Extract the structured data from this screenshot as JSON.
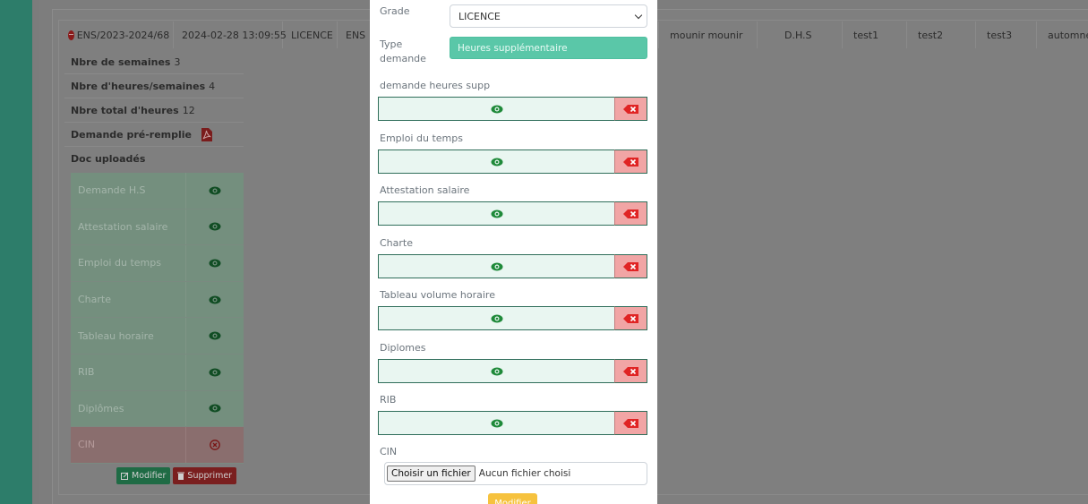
{
  "background_table": {
    "first_row": {
      "reference": "ENS/2023-2024/68",
      "date": "2024-02-28 13:09:55",
      "grade": "LICENCE",
      "type_short": "ENS",
      "name": "mounir mounir",
      "category": "D.H.S",
      "col_test1": "test1",
      "col_test2": "test2",
      "col_test3": "test3",
      "col_season": "automne"
    },
    "details": {
      "weeks_label": "Nbre de semaines",
      "weeks_value": "3",
      "hours_per_week_label": "Nbre d'heures/semaines",
      "hours_per_week_value": "4",
      "total_hours_label": "Nbre total d'heures",
      "total_hours_value": "12",
      "prefilled_label": "Demande pré-remplie",
      "uploaded_label": "Doc uploadés"
    },
    "docs": [
      {
        "name": "Demande H.S",
        "status": "ok"
      },
      {
        "name": "Attestation salaire",
        "status": "ok"
      },
      {
        "name": "Emploi du temps",
        "status": "ok"
      },
      {
        "name": "Charte",
        "status": "ok"
      },
      {
        "name": "Tableau horaire",
        "status": "ok"
      },
      {
        "name": "RIB",
        "status": "ok"
      },
      {
        "name": "Diplômes",
        "status": "ok"
      },
      {
        "name": "CIN",
        "status": "missing"
      }
    ],
    "actions": {
      "modify_label": "Modifier",
      "delete_label": "Supprimer"
    }
  },
  "modal": {
    "grade_label": "Grade",
    "grade_value": "LICENCE",
    "type_label": "Type demande",
    "type_value": "Heures supplémentaire",
    "files": [
      {
        "label": "demande heures supp"
      },
      {
        "label": "Emploi du temps"
      },
      {
        "label": "Attestation salaire"
      },
      {
        "label": "Charte"
      },
      {
        "label": "Tableau volume horaire"
      },
      {
        "label": "Diplomes"
      },
      {
        "label": "RIB"
      }
    ],
    "cin_label": "CIN",
    "cin_choose_button": "Choisir un fichier",
    "cin_no_file": "Aucun fichier choisi",
    "submit_label": "Modifier"
  },
  "colors": {
    "sidebar": "#2d7d6a",
    "accent_green": "#1f8a3a",
    "delete_red": "#e02424",
    "type_field": "#5ac7a8",
    "submit_button": "#f6c23e"
  }
}
